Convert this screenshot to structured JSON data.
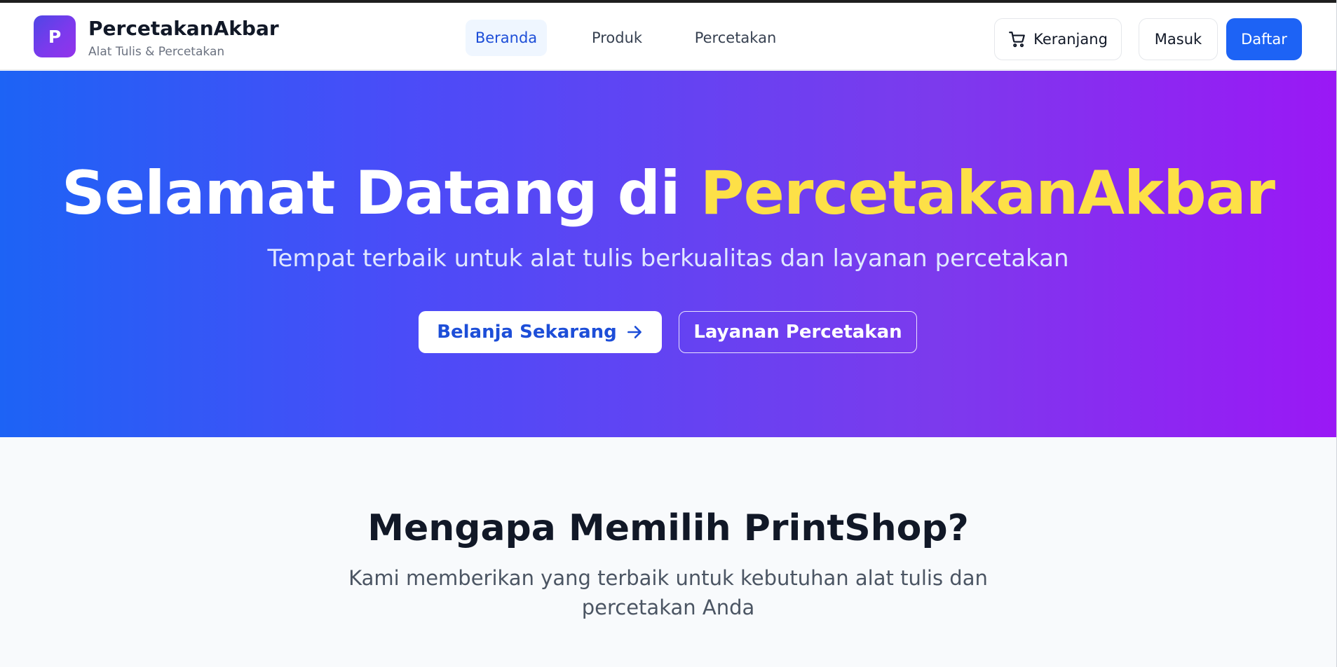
{
  "header": {
    "logo_letter": "P",
    "brand_name": "PercetakanAkbar",
    "brand_tagline": "Alat Tulis & Percetakan",
    "nav": [
      {
        "label": "Beranda",
        "active": true
      },
      {
        "label": "Produk",
        "active": false
      },
      {
        "label": "Percetakan",
        "active": false
      }
    ],
    "cart_label": "Keranjang",
    "login_label": "Masuk",
    "register_label": "Daftar"
  },
  "hero": {
    "title_prefix": "Selamat Datang di ",
    "title_accent": "PercetakanAkbar",
    "subtitle": "Tempat terbaik untuk alat tulis berkualitas dan layanan percetakan",
    "primary_cta": "Belanja Sekarang",
    "secondary_cta": "Layanan Percetakan"
  },
  "features": {
    "title": "Mengapa Memilih PrintShop?",
    "subtitle": "Kami memberikan yang terbaik untuk kebutuhan alat tulis dan percetakan Anda"
  },
  "colors": {
    "primary": "#1d63f5",
    "gradient_start": "#1d63f5",
    "gradient_end": "#9a18f5",
    "accent_yellow": "#fde047"
  },
  "icons": {
    "cart": "shopping-cart-icon",
    "arrow": "arrow-right-icon"
  }
}
